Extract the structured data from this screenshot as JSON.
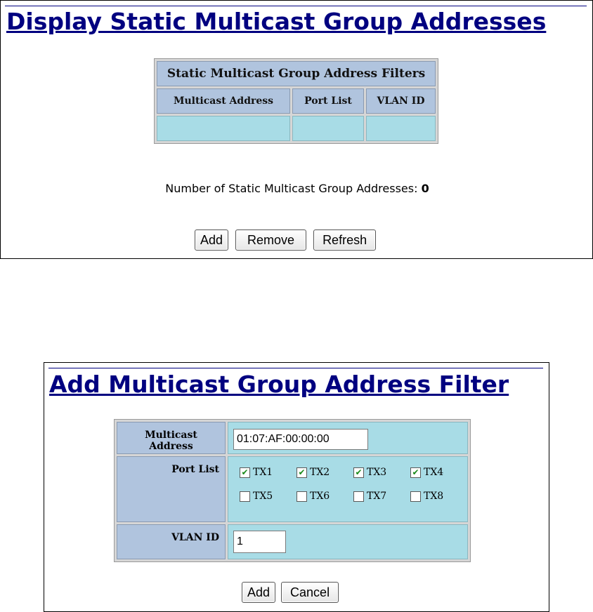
{
  "display": {
    "title": "Display Static Multicast Group Addresses",
    "table_caption": "Static Multicast Group Address Filters",
    "columns": [
      "Multicast Address",
      "Port List",
      "VLAN ID"
    ],
    "rows": [
      [
        "",
        "",
        ""
      ]
    ],
    "count_label": "Number of Static Multicast Group Addresses:",
    "count_value": "0",
    "buttons": {
      "add": "Add",
      "remove": "Remove",
      "refresh": "Refresh"
    }
  },
  "add_form": {
    "title": "Add Multicast Group Address Filter",
    "multicast_label": "Multicast Address",
    "multicast_value": "01:07:AF:00:00:00",
    "port_list_label": "Port List",
    "ports": [
      {
        "name": "TX1",
        "checked": true
      },
      {
        "name": "TX2",
        "checked": true
      },
      {
        "name": "TX3",
        "checked": true
      },
      {
        "name": "TX4",
        "checked": true
      },
      {
        "name": "TX5",
        "checked": false
      },
      {
        "name": "TX6",
        "checked": false
      },
      {
        "name": "TX7",
        "checked": false
      },
      {
        "name": "TX8",
        "checked": false
      }
    ],
    "vlan_label": "VLAN ID",
    "vlan_value": "1",
    "buttons": {
      "add": "Add",
      "cancel": "Cancel"
    }
  },
  "colors": {
    "title": "#000080",
    "header_cell": "#b0c4de",
    "data_cell": "#a8dce6",
    "checkmark": "#1a8a1a"
  }
}
